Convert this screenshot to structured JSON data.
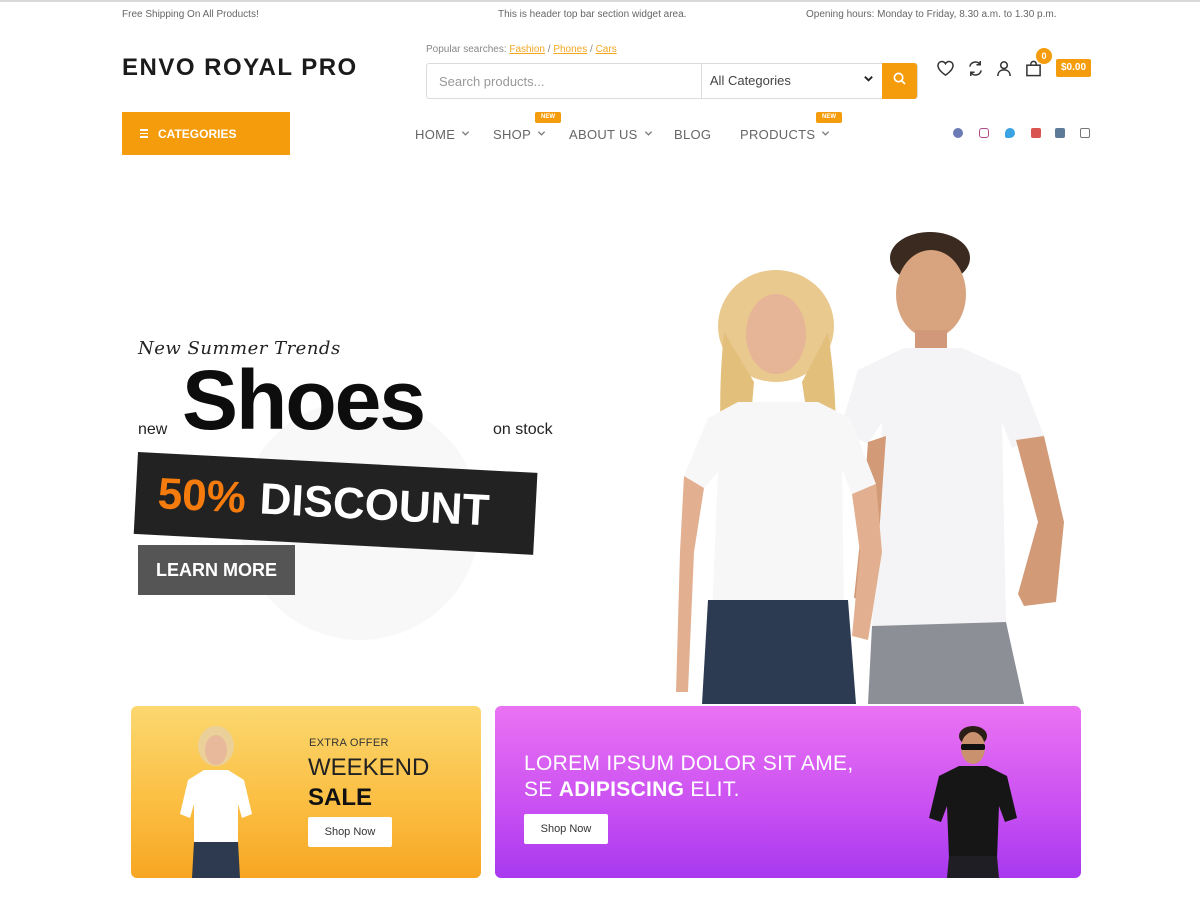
{
  "topbar": {
    "left": "Free Shipping On All Products!",
    "center": "This is header top bar section widget area.",
    "right": "Opening hours: Monday to Friday, 8.30 a.m. to 1.30 p.m."
  },
  "header": {
    "logo": "ENVO ROYAL PRO",
    "popular_label": "Popular searches:",
    "popular": [
      "Fashion",
      "Phones",
      "Cars"
    ],
    "search_placeholder": "Search products...",
    "category_select": "All Categories",
    "cart_count": "0",
    "cart_total": "$0.00",
    "icons": [
      "heart-icon",
      "compare-icon",
      "user-icon",
      "cart-icon"
    ]
  },
  "nav": {
    "categories_label": "CATEGORIES",
    "items": [
      {
        "label": "HOME",
        "dropdown": true,
        "badge": ""
      },
      {
        "label": "SHOP",
        "dropdown": true,
        "badge": "NEW"
      },
      {
        "label": "ABOUT US",
        "dropdown": true,
        "badge": ""
      },
      {
        "label": "BLOG",
        "dropdown": false,
        "badge": ""
      },
      {
        "label": "PRODUCTS",
        "dropdown": true,
        "badge": "NEW"
      }
    ],
    "social": [
      "facebook-icon",
      "instagram-icon",
      "twitter-icon",
      "youtube-icon",
      "linkedin-icon",
      "store-icon"
    ]
  },
  "hero": {
    "pretitle": "New Summer Trends",
    "small_left": "new",
    "title": "Shoes",
    "small_right": "on stock",
    "discount_pct": "50%",
    "discount_word": "DISCOUNT",
    "cta": "LEARN MORE"
  },
  "promos": [
    {
      "eyebrow": "EXTRA OFFER",
      "title": "WEEKEND",
      "subtitle": "SALE",
      "cta": "Shop Now"
    },
    {
      "line1": "LOREM IPSUM DOLOR SIT AME,",
      "line2_prefix": "SE ",
      "line2_bold": "ADIPISCING",
      "line2_suffix": " ELIT.",
      "cta": "Shop Now"
    }
  ],
  "colors": {
    "accent": "#f59c0c",
    "discount_orange": "#f57c0c",
    "dark": "#222222",
    "promo1_top": "#fbd870",
    "promo1_bottom": "#f7a622",
    "promo2_top": "#ea73f3",
    "promo2_bottom": "#a839f0"
  }
}
